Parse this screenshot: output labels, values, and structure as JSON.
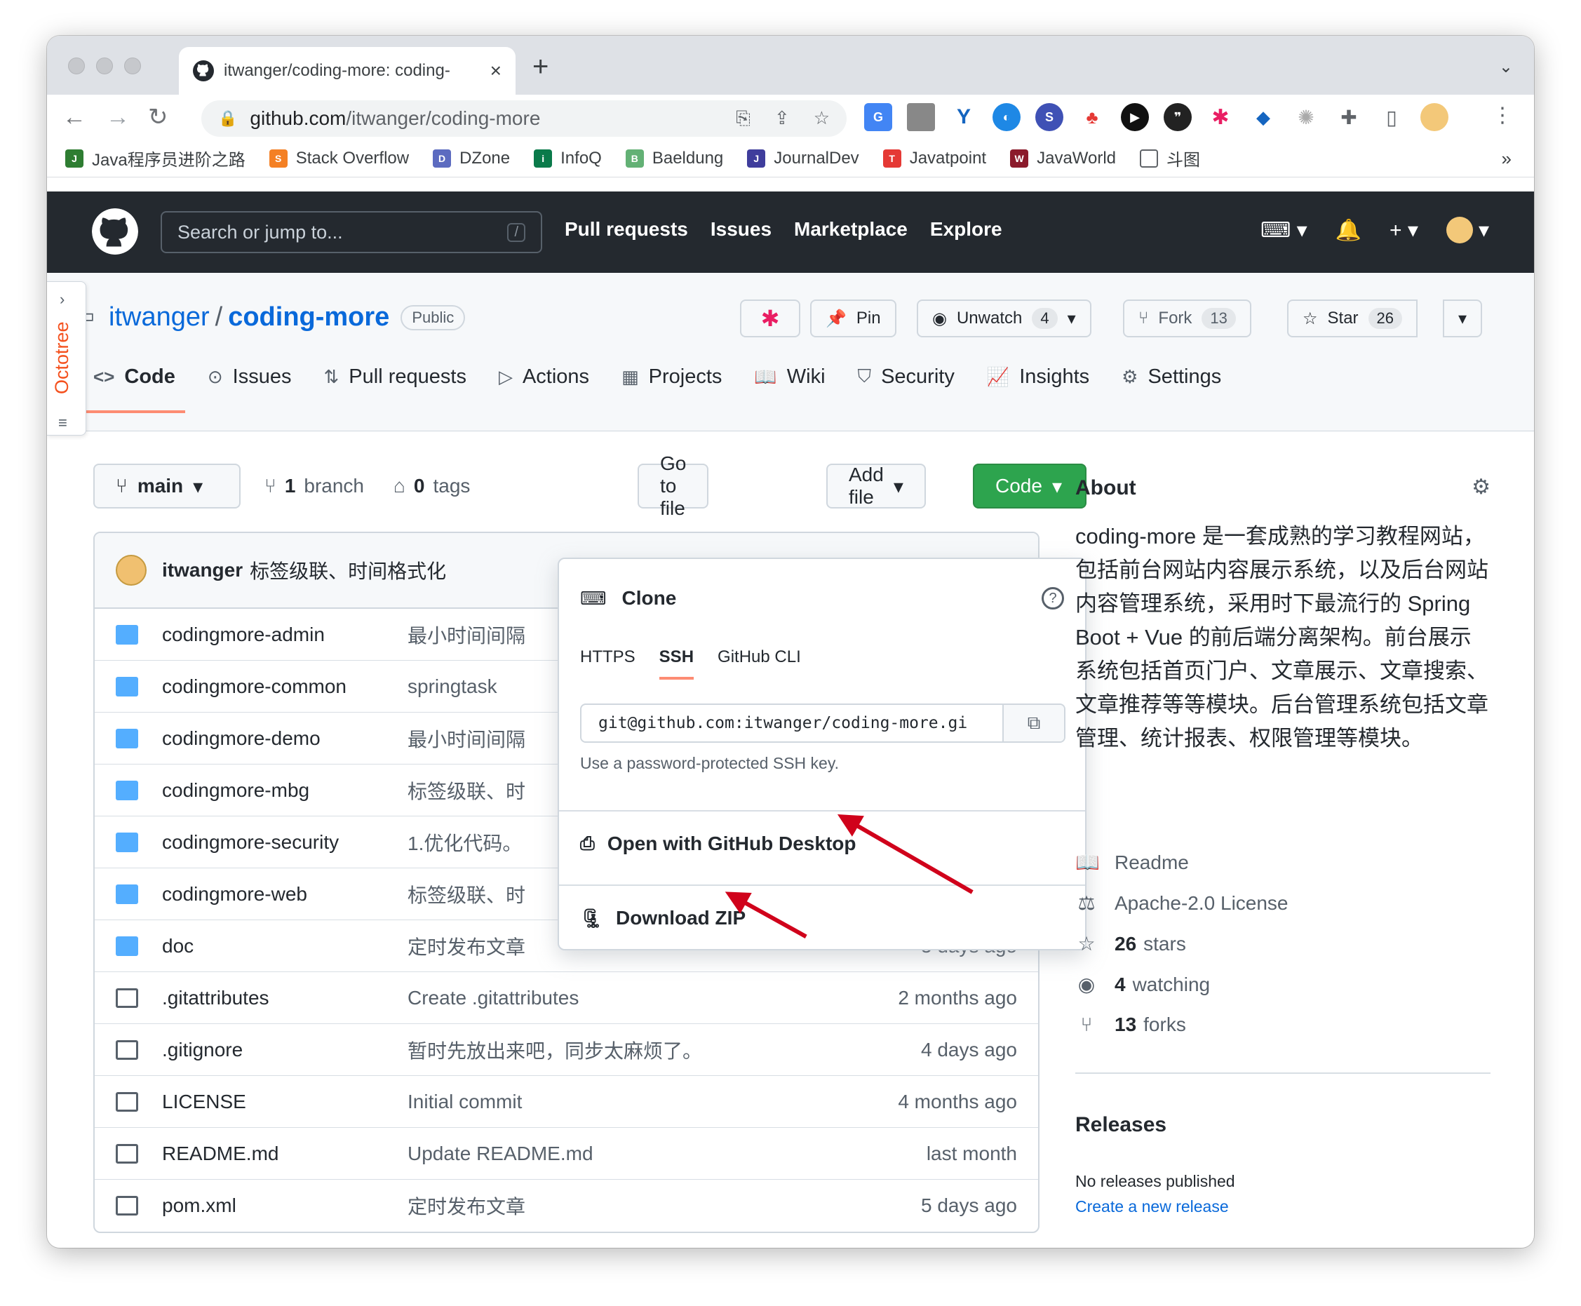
{
  "browser": {
    "tab_title": "itwanger/coding-more: coding-",
    "url_host": "github.com",
    "url_path": "/itwanger/coding-more",
    "bookmarks": [
      "Java程序员进阶之路",
      "Stack Overflow",
      "DZone",
      "InfoQ",
      "Baeldung",
      "JournalDev",
      "Javatpoint",
      "JavaWorld",
      "斗图"
    ],
    "bookmarks_more": "»"
  },
  "github_header": {
    "search_placeholder": "Search or jump to...",
    "search_shortcut": "/",
    "nav": [
      "Pull requests",
      "Issues",
      "Marketplace",
      "Explore"
    ]
  },
  "repo": {
    "owner": "itwanger",
    "separator": "/",
    "name": "coding-more",
    "visibility": "Public",
    "pin_label": "Pin",
    "unwatch_label": "Unwatch",
    "unwatch_count": "4",
    "fork_label": "Fork",
    "fork_count": "13",
    "star_label": "Star",
    "star_count": "26",
    "tabs": [
      {
        "label": "Code",
        "icon": "code-icon"
      },
      {
        "label": "Issues",
        "icon": "issue-icon"
      },
      {
        "label": "Pull requests",
        "icon": "pull-request-icon"
      },
      {
        "label": "Actions",
        "icon": "play-icon"
      },
      {
        "label": "Projects",
        "icon": "table-icon"
      },
      {
        "label": "Wiki",
        "icon": "book-icon"
      },
      {
        "label": "Security",
        "icon": "shield-icon"
      },
      {
        "label": "Insights",
        "icon": "graph-icon"
      },
      {
        "label": "Settings",
        "icon": "gear-icon"
      }
    ]
  },
  "octotree": {
    "label": "Octotree"
  },
  "code_bar": {
    "branch": "main",
    "branch_count": "1",
    "branch_word": "branch",
    "tag_count": "0",
    "tag_word": "tags",
    "go_to_file": "Go to file",
    "add_file": "Add file",
    "code": "Code"
  },
  "latest_commit": {
    "author": "itwanger",
    "message": "标签级联、时间格式化"
  },
  "files": [
    {
      "type": "folder",
      "name": "codingmore-admin",
      "message": "最小时间间隔",
      "time": ""
    },
    {
      "type": "folder",
      "name": "codingmore-common",
      "message": "springtask",
      "time": ""
    },
    {
      "type": "folder",
      "name": "codingmore-demo",
      "message": "最小时间间隔",
      "time": ""
    },
    {
      "type": "folder",
      "name": "codingmore-mbg",
      "message": "标签级联、时",
      "time": ""
    },
    {
      "type": "folder",
      "name": "codingmore-security",
      "message": "1.优化代码。",
      "time": ""
    },
    {
      "type": "folder",
      "name": "codingmore-web",
      "message": "标签级联、时",
      "time": ""
    },
    {
      "type": "folder",
      "name": "doc",
      "message": "定时发布文章",
      "time": "5 days ago"
    },
    {
      "type": "file",
      "name": ".gitattributes",
      "message": "Create .gitattributes",
      "time": "2 months ago"
    },
    {
      "type": "file",
      "name": ".gitignore",
      "message": "暂时先放出来吧，同步太麻烦了。",
      "time": "4 days ago"
    },
    {
      "type": "file",
      "name": "LICENSE",
      "message": "Initial commit",
      "time": "4 months ago"
    },
    {
      "type": "file",
      "name": "README.md",
      "message": "Update README.md",
      "time": "last month"
    },
    {
      "type": "file",
      "name": "pom.xml",
      "message": "定时发布文章",
      "time": "5 days ago"
    }
  ],
  "clone_dropdown": {
    "title": "Clone",
    "help": "?",
    "tabs": [
      "HTTPS",
      "SSH",
      "GitHub CLI"
    ],
    "active_tab": "SSH",
    "clone_url": "git@github.com:itwanger/coding-more.gi",
    "hint": "Use a password-protected SSH key.",
    "desktop": "Open with GitHub Desktop",
    "zip": "Download ZIP"
  },
  "about": {
    "heading": "About",
    "description": "coding-more 是一套成熟的学习教程网站，包括前台网站内容展示系统，以及后台网站内容管理系统，采用时下最流行的 Spring Boot + Vue 的前后端分离架构。前台展示系统包括首页门户、文章展示、文章搜索、文章推荐等等模块。后台管理系统包括文章管理、统计报表、权限管理等模块。",
    "readme": "Readme",
    "license": "Apache-2.0 License",
    "stars_count": "26",
    "stars_word": "stars",
    "watching_count": "4",
    "watching_word": "watching",
    "forks_count": "13",
    "forks_word": "forks"
  },
  "releases": {
    "heading": "Releases",
    "none": "No releases published",
    "create": "Create a new release"
  },
  "colors": {
    "accent": "#0969da",
    "header": "#24292f",
    "green": "#2da44e",
    "tab_underline": "#fd8c73",
    "arrow": "#d0021b"
  }
}
